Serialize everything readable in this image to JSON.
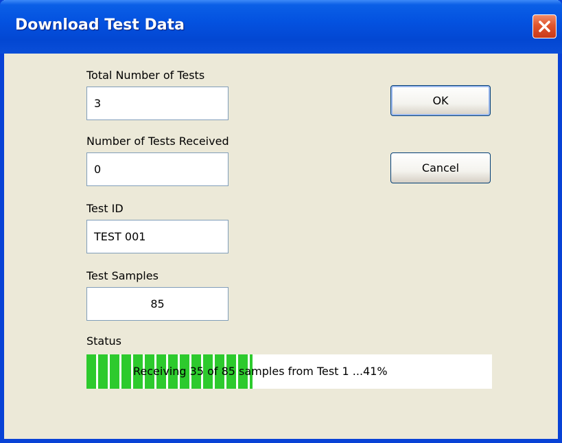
{
  "window": {
    "title": "Download Test Data"
  },
  "fields": {
    "total_tests": {
      "label": "Total Number of Tests",
      "value": "3"
    },
    "tests_received": {
      "label": "Number of Tests Received",
      "value": "0"
    },
    "test_id": {
      "label": "Test ID",
      "value": "TEST 001"
    },
    "test_samples": {
      "label": "Test Samples",
      "value": "85"
    }
  },
  "buttons": {
    "ok": "OK",
    "cancel": "Cancel"
  },
  "status": {
    "label": "Status",
    "text": "Receiving 35 of 85 samples from Test 1 ...41%",
    "progress_fraction": 0.41
  },
  "icons": {
    "close": "close-icon"
  },
  "colors": {
    "titlebar": "#0452e0",
    "progress": "#2dca2d",
    "close": "#e0552d"
  }
}
